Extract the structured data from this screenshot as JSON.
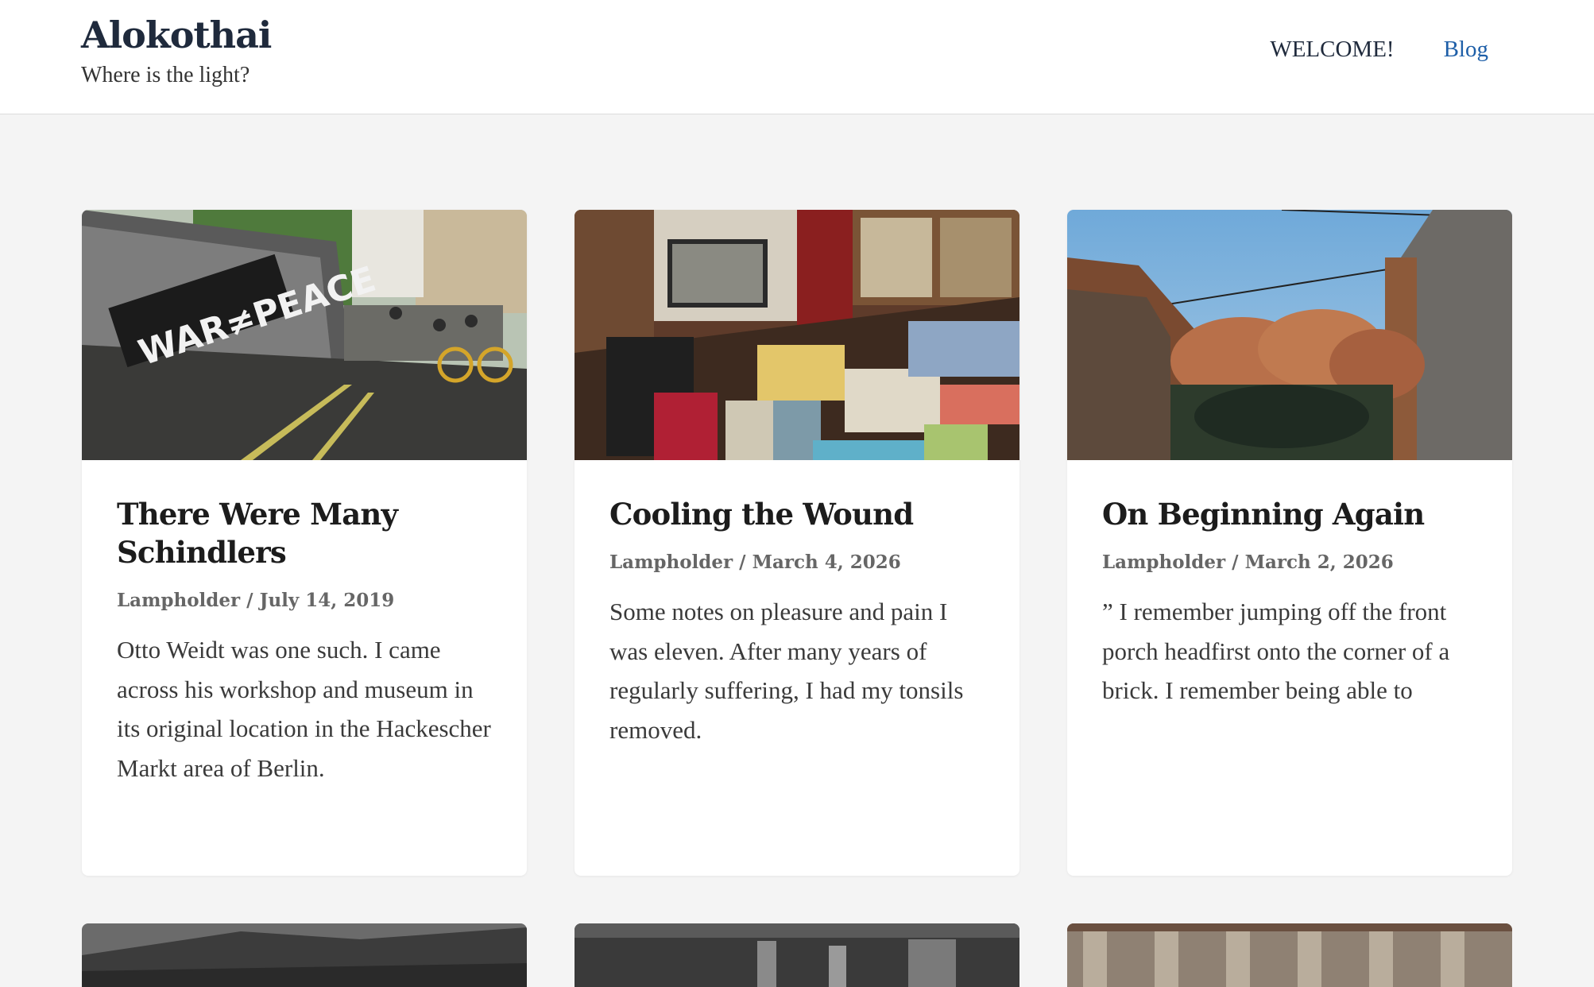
{
  "site": {
    "title": "Alokothai",
    "tagline": "Where is the light?"
  },
  "nav": {
    "welcome": "WELCOME!",
    "blog": "Blog"
  },
  "posts": [
    {
      "title": "There Were Many Schindlers",
      "author": "Lampholder",
      "separator": " / ",
      "date": "July 14, 2019",
      "excerpt": "Otto Weidt was one such. I came across his workshop and museum in its original location in the Hackescher Markt area of Berlin.",
      "image_text": "WAR≠PEACE"
    },
    {
      "title": "Cooling the Wound",
      "author": "Lampholder",
      "separator": " / ",
      "date": "March 4, 2026",
      "excerpt": "Some notes on pleasure and pain  I was eleven. After many years of regularly suffering, I had my tonsils removed."
    },
    {
      "title": "On Beginning Again",
      "author": "Lampholder",
      "separator": " / ",
      "date": "March 2, 2026",
      "excerpt": "” I remember jumping off the front porch headfirst onto the corner of a brick. I remember being able to"
    }
  ]
}
